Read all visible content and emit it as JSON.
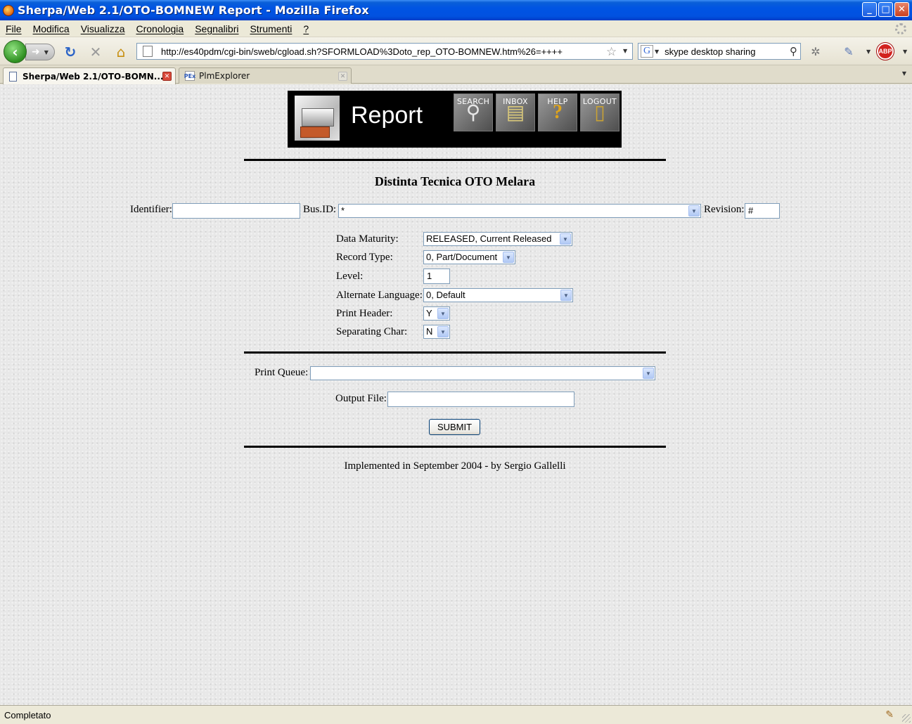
{
  "window": {
    "title": "Sherpa/Web 2.1/OTO-BOMNEW Report - Mozilla Firefox"
  },
  "menu": [
    "File",
    "Modifica",
    "Visualizza",
    "Cronologia",
    "Segnalibri",
    "Strumenti",
    "?"
  ],
  "nav": {
    "url": "http://es40pdm/cgi-bin/sweb/cgload.sh?SFORMLOAD%3Doto_rep_OTO-BOMNEW.htm%26=++++",
    "search_value": "skype desktop sharing",
    "search_engine_icon": "G",
    "abp_label": "ABP"
  },
  "tabs": [
    {
      "label": "Sherpa/Web 2.1/OTO-BOMN...",
      "active": true
    },
    {
      "label": "PlmExplorer",
      "active": false,
      "icon_text": "PEx"
    }
  ],
  "banner": {
    "title": "Report",
    "buttons": {
      "search": "SEARCH",
      "inbox": "INBOX",
      "help": "HELP",
      "logout": "LOGOUT"
    }
  },
  "form": {
    "heading": "Distinta Tecnica OTO Melara",
    "identifier_label": "Identifier:",
    "identifier_value": "",
    "busid_label": "Bus.ID:",
    "busid_value": "*",
    "revision_label": "Revision:",
    "revision_value": "#",
    "data_maturity_label": "Data Maturity:",
    "data_maturity_value": "RELEASED, Current Released",
    "record_type_label": "Record Type:",
    "record_type_value": "0, Part/Document",
    "level_label": "Level:",
    "level_value": "1",
    "alt_language_label": "Alternate Language:",
    "alt_language_value": "0, Default",
    "print_header_label": "Print Header:",
    "print_header_value": "Y",
    "separating_char_label": "Separating Char:",
    "separating_char_value": "N",
    "print_queue_label": "Print Queue:",
    "print_queue_value": "",
    "output_file_label": "Output File:",
    "output_file_value": "",
    "submit_label": "SUBMIT"
  },
  "footer_note": "Implemented in September 2004 - by Sergio Gallelli",
  "status": {
    "text": "Completato"
  }
}
